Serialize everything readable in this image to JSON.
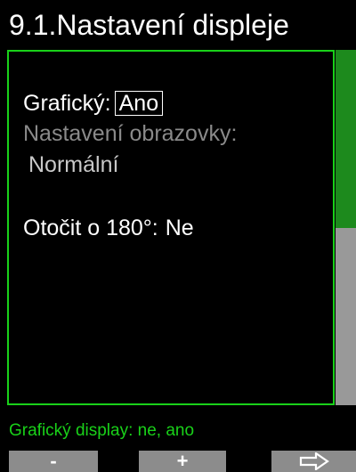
{
  "header": {
    "title": "9.1.Nastavení displeje"
  },
  "settings": {
    "graphic": {
      "label": "Grafický:",
      "value": "Ano"
    },
    "screen": {
      "label": "Nastavení obrazovky:",
      "value": "Normální"
    },
    "rotate": {
      "label": "Otočit o 180°:",
      "value": "Ne"
    }
  },
  "scrollbar": {
    "visible_fraction": 0.5
  },
  "help": {
    "text": "Grafický display: ne, ano"
  },
  "softkeys": {
    "minus": "-",
    "plus": "+",
    "next_icon": "right-arrow-icon"
  },
  "colors": {
    "accent": "#19d119",
    "scrollbar_thumb": "#1d8a1d",
    "scrollbar_track": "#999999",
    "softkey_bg": "#8c8c8c",
    "muted_text": "#8a8a8a"
  }
}
